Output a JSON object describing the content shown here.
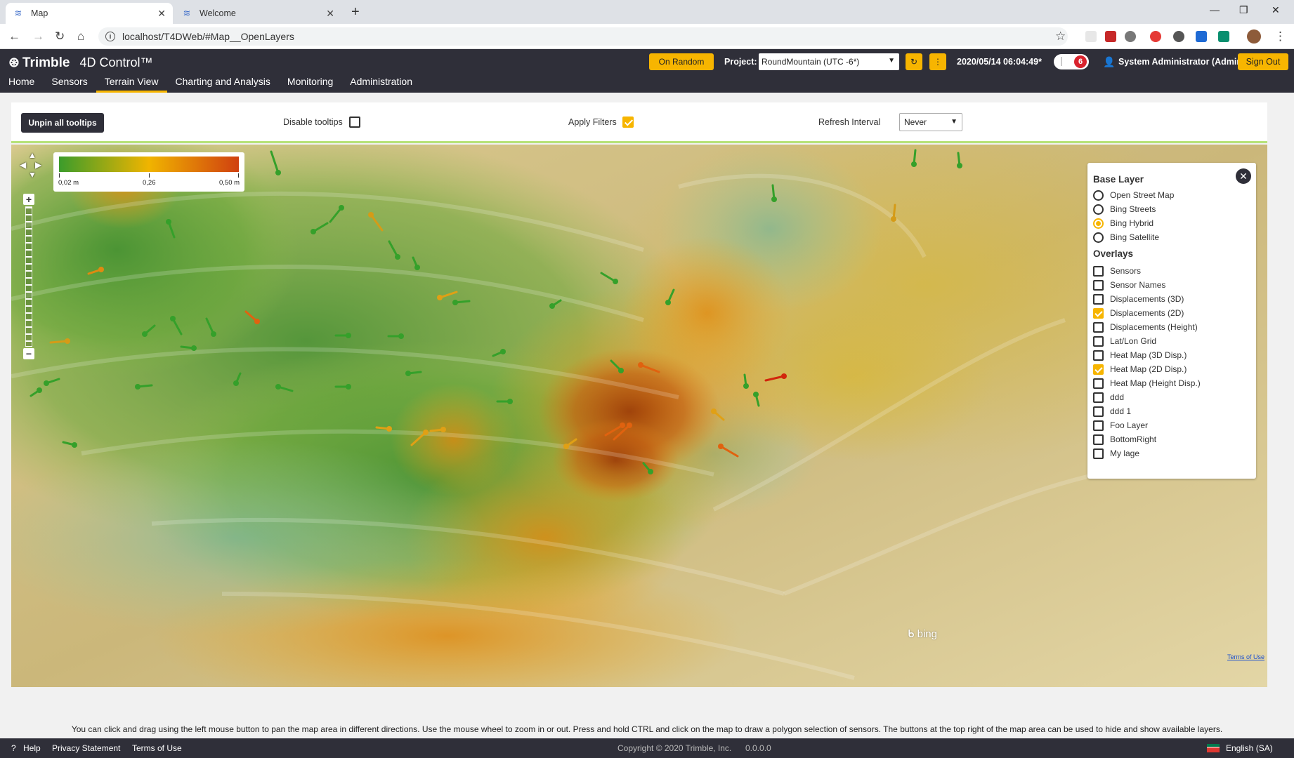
{
  "browser": {
    "tabs": [
      {
        "title": "Map",
        "active": true
      },
      {
        "title": "Welcome",
        "active": false
      }
    ],
    "url": "localhost/T4DWeb/#Map__OpenLayers"
  },
  "app": {
    "brand": "Trimble",
    "product": "4D Control™",
    "menu": [
      "Home",
      "Sensors",
      "Terrain View",
      "Charting and Analysis",
      "Monitoring",
      "Administration"
    ],
    "active_menu": "Terrain View",
    "on_random_label": "On Random",
    "project_label": "Project:",
    "project_value": "RoundMountain (UTC -6*)",
    "datetime": "2020/05/14 06:04:49*",
    "notification_count": "6",
    "user": "System Administrator (Admin)",
    "sign_out_label": "Sign Out"
  },
  "toolbar": {
    "unpin_label": "Unpin all tooltips",
    "disable_tooltips_label": "Disable tooltips",
    "disable_tooltips_checked": false,
    "apply_filters_label": "Apply Filters",
    "apply_filters_checked": true,
    "refresh_label": "Refresh Interval",
    "refresh_value": "Never"
  },
  "legend": {
    "min": "0,02 m",
    "mid": "0,26",
    "max": "0,50 m"
  },
  "layers": {
    "base_title": "Base Layer",
    "base": [
      "Open Street Map",
      "Bing Streets",
      "Bing Hybrid",
      "Bing Satellite"
    ],
    "base_selected": "Bing Hybrid",
    "overlays_title": "Overlays",
    "overlays": [
      {
        "label": "Sensors",
        "checked": false
      },
      {
        "label": "Sensor Names",
        "checked": false
      },
      {
        "label": "Displacements (3D)",
        "checked": false
      },
      {
        "label": "Displacements (2D)",
        "checked": true
      },
      {
        "label": "Displacements (Height)",
        "checked": false
      },
      {
        "label": "Lat/Lon Grid",
        "checked": false
      },
      {
        "label": "Heat Map (3D Disp.)",
        "checked": false
      },
      {
        "label": "Heat Map (2D Disp.)",
        "checked": true
      },
      {
        "label": "Heat Map (Height Disp.)",
        "checked": false
      },
      {
        "label": "ddd",
        "checked": false
      },
      {
        "label": "ddd 1",
        "checked": false
      },
      {
        "label": "Foo Layer",
        "checked": false
      },
      {
        "label": "BottomRight",
        "checked": false
      },
      {
        "label": "My lage",
        "checked": false
      }
    ]
  },
  "map": {
    "provider": "bing",
    "terms_label": "Terms of Use"
  },
  "hint": "You can click and drag using the left mouse button to pan the map area in different directions. Use the mouse wheel to zoom in or out. Press and hold CTRL and click on the map to draw a polygon selection of sensors. The buttons at the top right of the map area can be used to hide and show available layers.",
  "footer": {
    "help": "Help",
    "privacy": "Privacy Statement",
    "terms": "Terms of Use",
    "copyright": "Copyright © 2020  Trimble, Inc.",
    "version": "0.0.0.0",
    "language": "English (SA)"
  },
  "colors": {
    "accent": "#f7b500",
    "header": "#2f2f39",
    "low": "#3b9c2b",
    "mid": "#f0b400",
    "high": "#d04010"
  }
}
